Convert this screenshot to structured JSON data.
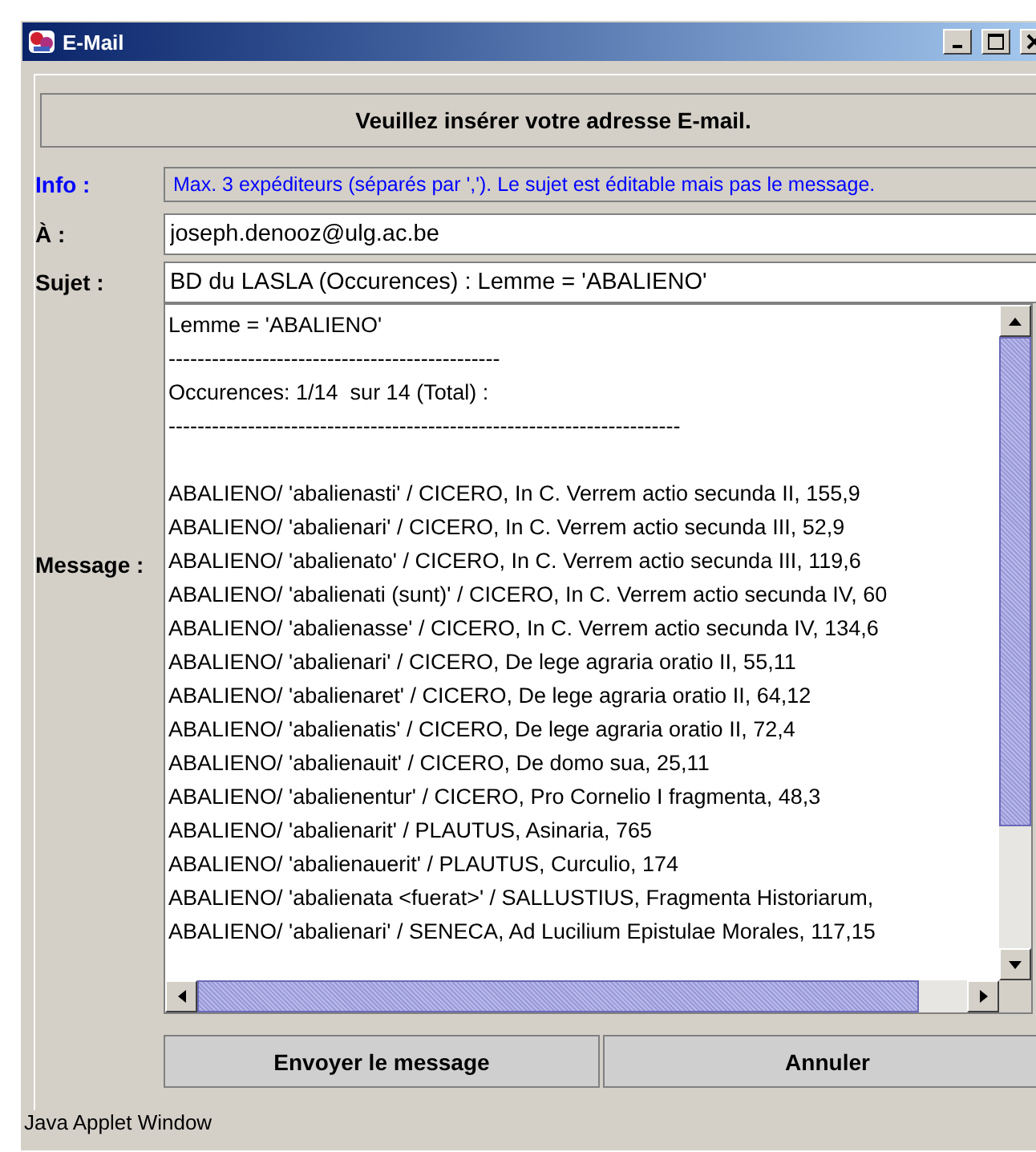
{
  "window": {
    "title": "E-Mail"
  },
  "header": "Veuillez insérer votre adresse E-mail.",
  "info": {
    "label": "Info :",
    "text": "Max. 3 expéditeurs (séparés par ','). Le sujet est éditable mais pas le message."
  },
  "to": {
    "label": "À :",
    "value": "joseph.denooz@ulg.ac.be"
  },
  "subject": {
    "label": "Sujet :",
    "value": "BD du LASLA (Occurences) : Lemme = 'ABALIENO'"
  },
  "message": {
    "label": "Message :",
    "header_lines": [
      "Lemme = 'ABALIENO'",
      "----------------------------------------------",
      "Occurences: 1/14  sur 14 (Total) :",
      "-----------------------------------------------------------------------"
    ],
    "entries": [
      "ABALIENO/ 'abalienasti' / CICERO, In C. Verrem actio secunda II, 155,9",
      "ABALIENO/ 'abalienari' / CICERO, In C. Verrem actio secunda III, 52,9",
      "ABALIENO/ 'abalienato' / CICERO, In C. Verrem actio secunda III, 119,6",
      "ABALIENO/ 'abalienati (sunt)' / CICERO, In C. Verrem actio secunda IV, 60",
      "ABALIENO/ 'abalienasse' / CICERO, In C. Verrem actio secunda IV, 134,6",
      "ABALIENO/ 'abalienari' / CICERO, De lege agraria oratio II, 55,11",
      "ABALIENO/ 'abalienaret' / CICERO, De lege agraria oratio II, 64,12",
      "ABALIENO/ 'abalienatis' / CICERO, De lege agraria oratio II, 72,4",
      "ABALIENO/ 'abalienauit' / CICERO, De domo sua, 25,11",
      "ABALIENO/ 'abalienentur' / CICERO, Pro Cornelio I fragmenta, 48,3",
      "ABALIENO/ 'abalienarit' / PLAUTUS, Asinaria, 765",
      "ABALIENO/ 'abalienauerit' / PLAUTUS, Curculio, 174",
      "ABALIENO/ 'abalienata <fuerat>' / SALLUSTIUS, Fragmenta Historiarum,",
      "ABALIENO/ 'abalienari' / SENECA, Ad Lucilium Epistulae Morales, 117,15"
    ]
  },
  "buttons": [
    "Envoyer le message",
    "Annuler"
  ],
  "status_bar": "Java Applet Window"
}
